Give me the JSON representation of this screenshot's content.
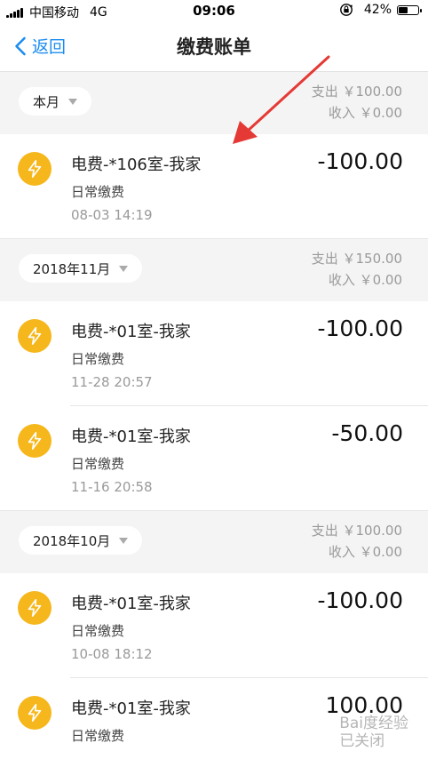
{
  "status_bar": {
    "carrier": "中国移动",
    "network": "4G",
    "time": "09:06",
    "battery_percent_text": "42%",
    "battery_level": 0.42
  },
  "nav": {
    "back_label": "返回",
    "title": "缴费账单"
  },
  "sections": [
    {
      "month": "本月",
      "expense": "支出 ￥100.00",
      "income": "收入 ￥0.00",
      "records": [
        {
          "name": "电费-*106室-我家",
          "type": "日常缴费",
          "time": "08-03  14:19",
          "amount": "-100.00"
        }
      ]
    },
    {
      "month": "2018年11月",
      "expense": "支出 ￥150.00",
      "income": "收入 ￥0.00",
      "records": [
        {
          "name": "电费-*01室-我家",
          "type": "日常缴费",
          "time": "11-28  20:57",
          "amount": "-100.00"
        },
        {
          "name": "电费-*01室-我家",
          "type": "日常缴费",
          "time": "11-16  20:58",
          "amount": "-50.00"
        }
      ]
    },
    {
      "month": "2018年10月",
      "expense": "支出 ￥100.00",
      "income": "收入 ￥0.00",
      "records": [
        {
          "name": "电费-*01室-我家",
          "type": "日常缴费",
          "time": "10-08  18:12",
          "amount": "-100.00"
        },
        {
          "name": "电费-*01室-我家",
          "type": "日常缴费",
          "time": "",
          "amount": "100.00"
        }
      ]
    }
  ],
  "watermark": {
    "line1": "Bai度经验",
    "line2": "已关闭"
  },
  "colors": {
    "accent_blue": "#1a8cf0",
    "bolt_yellow": "#f6b71c",
    "annotation_red": "#e53935",
    "section_bg": "#f4f4f4"
  },
  "icons": [
    "signal-icon",
    "orientation-lock-icon",
    "battery-icon",
    "chevron-left-icon",
    "caret-down-icon",
    "lightning-bolt-icon",
    "arrow-annotation"
  ]
}
